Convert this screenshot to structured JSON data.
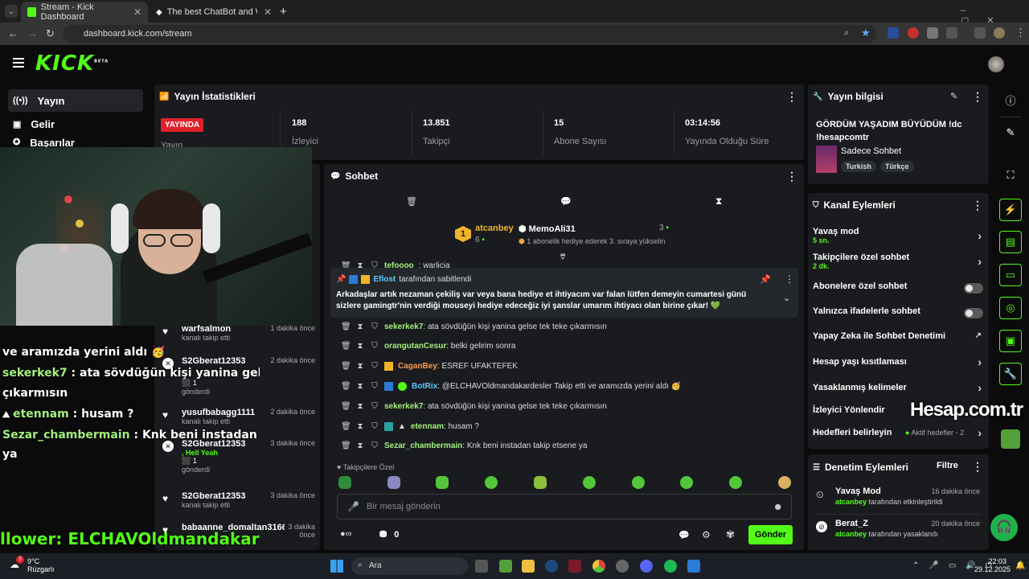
{
  "browser": {
    "tabs": [
      {
        "title": "Stream - Kick Dashboard"
      },
      {
        "title": "The best ChatBot and Widgets "
      }
    ],
    "url": "dashboard.kick.com/stream"
  },
  "kick": {
    "logo": "KICK",
    "logo_badge": "BETA"
  },
  "leftnav": [
    {
      "label": "Yayın",
      "icon": "broadcast-icon"
    },
    {
      "label": "Gelir",
      "icon": "chart-icon"
    },
    {
      "label": "Başarılar",
      "icon": "award-icon"
    }
  ],
  "stats": {
    "title": "Yayın İstatistikleri",
    "live_label": "YAYINDA",
    "first_label": "Yayın",
    "items": [
      {
        "value": "188",
        "label": "İzleyici"
      },
      {
        "value": "13.851",
        "label": "Takipçi"
      },
      {
        "value": "15",
        "label": "Abone Sayısı"
      },
      {
        "value": "03:14:56",
        "label": "Yayında Olduğu Süre"
      }
    ]
  },
  "overlay": {
    "lines": [
      {
        "text": "ve aramızda yerini aldı 🥳"
      },
      {
        "name": "sekerkek7",
        "text": " : ata sövdüğün kişi yanina gelse te"
      },
      {
        "text": "çıkarmısın"
      },
      {
        "name": "etennam",
        "text": " : husam ?"
      },
      {
        "name": "Sezar_chambermain",
        "text": " : Knk beni instadan takip"
      },
      {
        "text": "ya"
      }
    ],
    "bottom": "llower: ELCHAVOldmandakar"
  },
  "feed": [
    {
      "name": "warfsalmon",
      "sub": "kanalı takip etti",
      "time": "1 dakika önce",
      "icon": "heart-icon"
    },
    {
      "name": "S2Gberat12353",
      "sub": "",
      "extra": "1",
      "extra2": "gönderdi",
      "time": "2 dakika önce",
      "icon": "gift-icon"
    },
    {
      "name": "yusufbabagg1111",
      "sub": "kanalı takip etti",
      "time": "2 dakika önce",
      "icon": "heart-icon"
    },
    {
      "name": "S2Gberat12353",
      "sub": ", Hell Yeah",
      "extra": "1",
      "extra2": "gönderdi",
      "time": "3 dakika önce",
      "icon": "gift-icon"
    },
    {
      "name": "S2Gberat12353",
      "sub": "kanalı takip etti",
      "time": "3 dakika önce",
      "icon": "heart-icon"
    },
    {
      "name": "babaanne_domaltan3166",
      "sub": "",
      "time": "3 dakika önce",
      "icon": "heart-icon"
    }
  ],
  "chat": {
    "title": "Sohbet",
    "top_gifter": {
      "name": "atcanbey",
      "count": "6",
      "rank": "1"
    },
    "second": {
      "name": "MemoAli31",
      "count": "3",
      "note": "1 abonelik hediye ederek 3. sıraya yükselin"
    },
    "cut_message": {
      "name": "tefoooo",
      "text": ": warlicia"
    },
    "pinned": {
      "by": "Eflost",
      "by_suffix": "tarafından sabitlendi",
      "text": "Arkadaşlar artık nezaman çekiliş var veya bana hediye et ihtiyacım var falan lütfen demeyin cumartesi günü sizlere gamingtr'nin verdiği mouseyi hediye edeceğiz iyi şanslar umarım ihtiyacı olan birine çıkar! 💚"
    },
    "messages": [
      {
        "name": "sekerkek7",
        "text": ": ata sövdüğün kişi yanina gelse tek teke çıkarmısın",
        "color": "#a3f07c"
      },
      {
        "name": "orangutanCesur",
        "text": ": belki gelirim sonra",
        "color": "#a3f07c"
      },
      {
        "name": "CaganBey",
        "text": ": ESREF UFAKTEFEK",
        "color": "#ff9a4a"
      },
      {
        "name": "BotRix",
        "text": ": @ELCHAVOldmandakardesler Takip etti ve aramızda yerini aldı 🥳",
        "color": "#5ec8ff"
      },
      {
        "name": "sekerkek7",
        "text": ": ata sövdüğün kişi yanina gelse tek teke çıkarmısın",
        "color": "#a3f07c"
      },
      {
        "name": "etennam",
        "text": ": husam ?",
        "color": "#a3f07c"
      },
      {
        "name": "Sezar_chambermain",
        "text": ": Knk beni instadan takip etsene ya",
        "color": "#a3f07c"
      }
    ],
    "emote_section": "Takipçilere Özel",
    "input_placeholder": "Bir mesaj gönderin",
    "points": "0",
    "send_label": "Gönder"
  },
  "stream_info": {
    "title": "Yayın bilgisi",
    "stream_title": "GÖRDÜM YAŞADIM BÜYÜDÜM !dc !hesapcomtr",
    "category": "Sadece Sohbet",
    "tags": [
      "Turkish",
      "Türkçe"
    ]
  },
  "channel_actions": {
    "title": "Kanal Eylemleri",
    "items": [
      {
        "label": "Yavaş mod",
        "sub": "5 sn.",
        "control": "chevron"
      },
      {
        "label": "Takipçilere özel sohbet",
        "sub": "2 dk.",
        "control": "chevron"
      },
      {
        "label": "Abonelere özel sohbet",
        "sub": "",
        "control": "toggle"
      },
      {
        "label": "Yalnızca ifadelerle sohbet",
        "sub": "",
        "control": "toggle"
      },
      {
        "label": "Yapay Zeka ile Sohbet Denetimi",
        "sub": "",
        "control": "external"
      },
      {
        "label": "Hesap yaşı kısıtlaması",
        "sub": "",
        "control": "chevron"
      },
      {
        "label": "Yasaklanmış kelimeler",
        "sub": "",
        "control": "chevron"
      },
      {
        "label": "İzleyici Yönlendir",
        "sub": "",
        "control": "none"
      },
      {
        "label": "Hedefleri belirleyin",
        "sub": "",
        "control": "chevron",
        "badge": "Aktif hedefler - 2"
      }
    ]
  },
  "watermark": "Hesap.com.tr",
  "mod_actions": {
    "title": "Denetim Eylemleri",
    "filter": "Filtre",
    "items": [
      {
        "title": "Yavaş Mod",
        "time": "16 dakika önce",
        "actor": "atcanbey",
        "desc": "tarafından etkinleştirildi"
      },
      {
        "title": "Berat_Z",
        "time": "20 dakika önce",
        "actor": "atcanbey",
        "desc": "tarafından yasaklandı"
      }
    ]
  },
  "taskbar": {
    "temp": "9°C",
    "weather": "Rüzgarlı",
    "search": "Ara",
    "time": "22:03",
    "date": "29.12.2025",
    "notif": "3"
  },
  "colors": {
    "accent": "#53fc18",
    "live": "#e0202b",
    "panel": "#191b1f"
  }
}
